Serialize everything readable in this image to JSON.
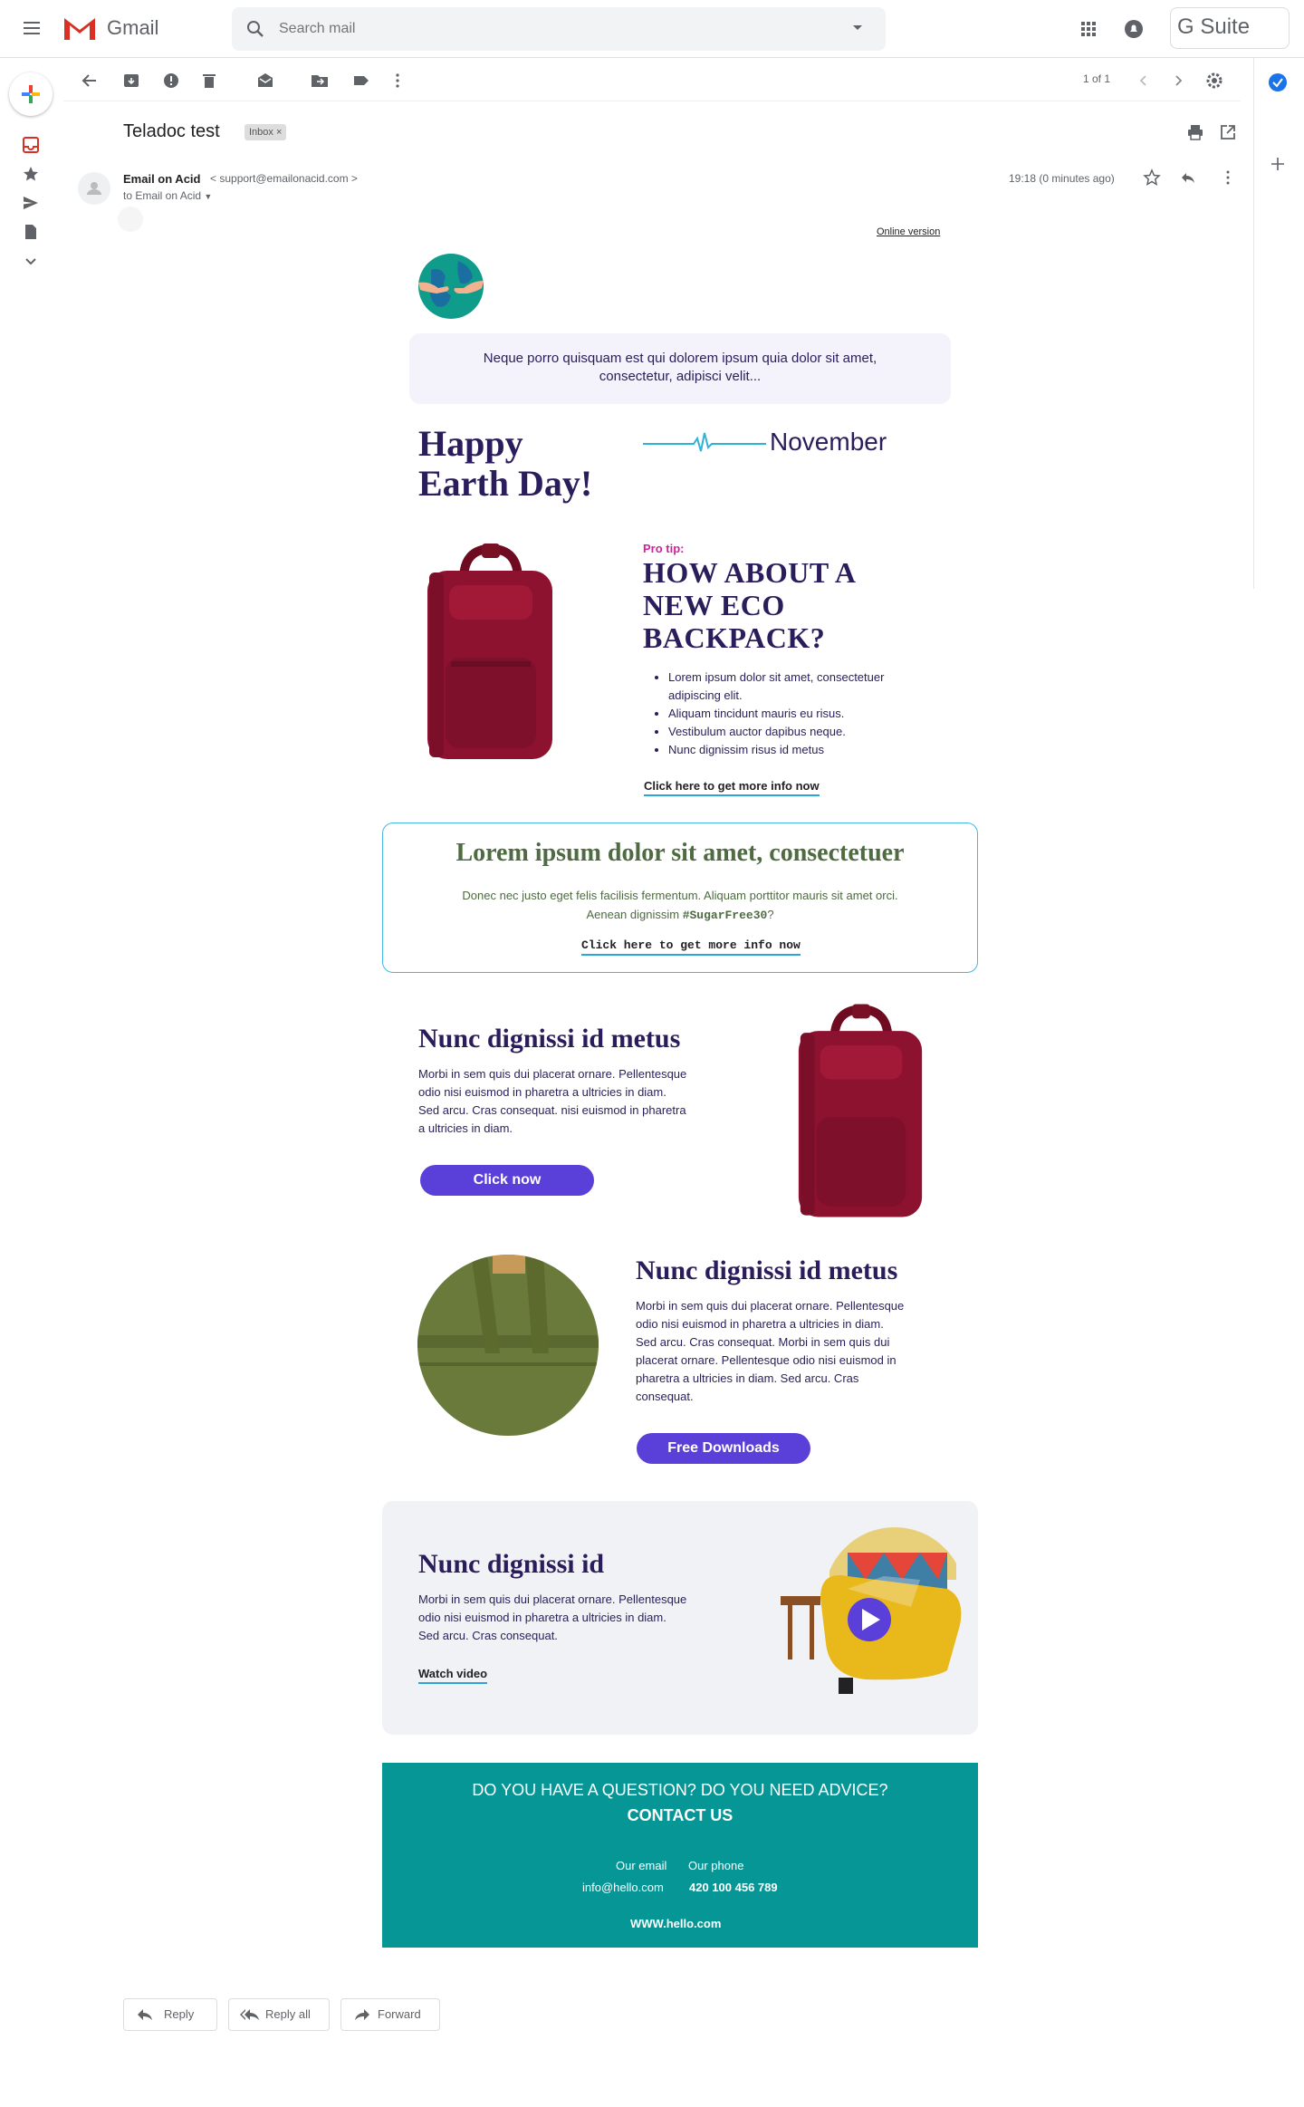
{
  "header": {
    "app_name": "Gmail",
    "search_placeholder": "Search mail",
    "brand": "G Suite"
  },
  "toolbar": {
    "page_count": "1 of 1"
  },
  "email": {
    "subject": "Teladoc test",
    "label": "Inbox",
    "label_close": "×",
    "sender_name": "Email on Acid",
    "sender_email": "< support@emailonacid.com >",
    "to_line": "to Email on Acid",
    "timestamp": "19:18 (0 minutes ago)"
  },
  "body": {
    "online_version": "Online version",
    "intro": "Neque porro quisquam est qui dolorem ipsum quia dolor sit amet, consectetur, adipisci velit...",
    "earth_line1": "Happy",
    "earth_line2": "Earth Day!",
    "month": "November",
    "pro_tip": "Pro tip:",
    "tip_title": "HOW ABOUT A NEW ECO BACKPACK?",
    "bullets": [
      "Lorem ipsum dolor sit amet, consectetuer adipiscing elit.",
      "Aliquam tincidunt mauris eu risus.",
      "Vestibulum auctor dapibus neque.",
      "Nunc dignissim risus id metus"
    ],
    "tip_link": "Click here to get more info now",
    "box2_title": "Lorem ipsum dolor sit amet, consectetuer",
    "box2_text_line1": "Donec nec justo eget felis facilisis fermentum. Aliquam porttitor mauris sit amet orci.",
    "box2_text_line2_pre": "Aenean dignissim ",
    "box2_hashtag": "#SugarFree30",
    "box2_text_line2_post": "?",
    "box2_link": "Click here to get more info now",
    "n1_title": "Nunc dignissi id metus",
    "n1_text": "Morbi in sem quis dui placerat ornare. Pellentesque odio nisi euismod in pharetra a ultricies in diam. Sed arcu. Cras consequat. nisi euismod in pharetra a ultricies in diam.",
    "n1_button": "Click now",
    "n2_title": "Nunc dignissi id metus",
    "n2_text": "Morbi in sem quis dui placerat ornare. Pellentesque odio nisi euismod in pharetra a ultricies in diam. Sed arcu. Cras consequat. Morbi in sem quis dui placerat ornare. Pellentesque odio nisi euismod in pharetra a ultricies in diam. Sed arcu. Cras consequat.",
    "n2_button": "Free Downloads",
    "v_title": "Nunc dignissi id",
    "v_text": "Morbi in sem quis dui placerat ornare. Pellentesque odio nisi euismod in pharetra a ultricies in diam. Sed arcu. Cras consequat.",
    "v_link": "Watch video",
    "footer_question": "DO YOU HAVE A QUESTION? DO YOU NEED ADVICE?",
    "footer_contact": "CONTACT US",
    "footer_email_label": "Our email",
    "footer_phone_label": "Our phone",
    "footer_email": "info@hello.com",
    "footer_phone": "420 100 456 789",
    "footer_www": "WWW.hello.com"
  },
  "actions": {
    "reply": "Reply",
    "reply_all": "Reply all",
    "forward": "Forward"
  },
  "colors": {
    "accent_purple": "#5b3fd9",
    "text_purple": "#2b1d5c",
    "teal_footer": "#069696",
    "box_border": "#44b7e2"
  }
}
